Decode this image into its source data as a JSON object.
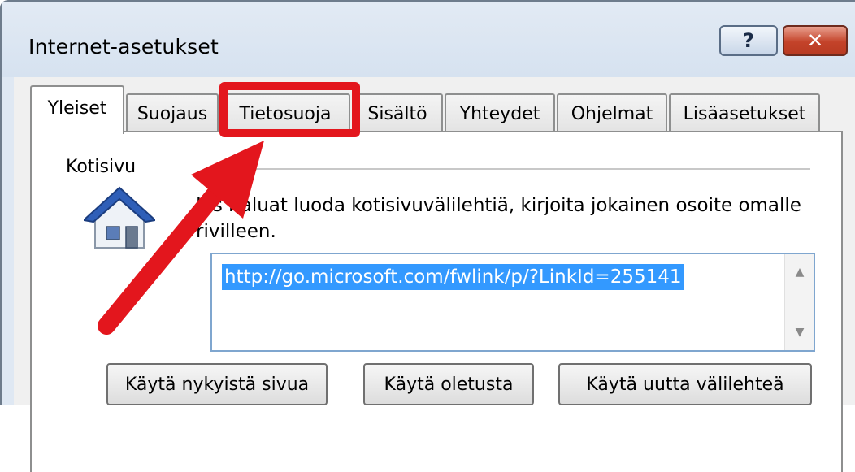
{
  "window": {
    "title": "Internet-asetukset"
  },
  "titlebar": {
    "help_label": "?",
    "close_label": "✕"
  },
  "tabs": [
    {
      "label": "Yleiset",
      "active": true
    },
    {
      "label": "Suojaus"
    },
    {
      "label": "Tietosuoja",
      "highlighted": true
    },
    {
      "label": "Sisältö"
    },
    {
      "label": "Yhteydet"
    },
    {
      "label": "Ohjelmat"
    },
    {
      "label": "Lisäasetukset"
    }
  ],
  "homepage": {
    "group_label": "Kotisivu",
    "description": "Jos haluat luoda kotisivuvälilehtiä, kirjoita jokainen osoite omalle rivilleen.",
    "url_value": "http://go.microsoft.com/fwlink/p/?LinkId=255141"
  },
  "buttons": {
    "use_current": "Käytä nykyistä sivua",
    "use_default": "Käytä oletusta",
    "use_new_tab": "Käytä uutta välilehteä"
  },
  "colors": {
    "highlight": "#e3161d",
    "selection": "#3399ff",
    "close_button": "#c4432a"
  }
}
